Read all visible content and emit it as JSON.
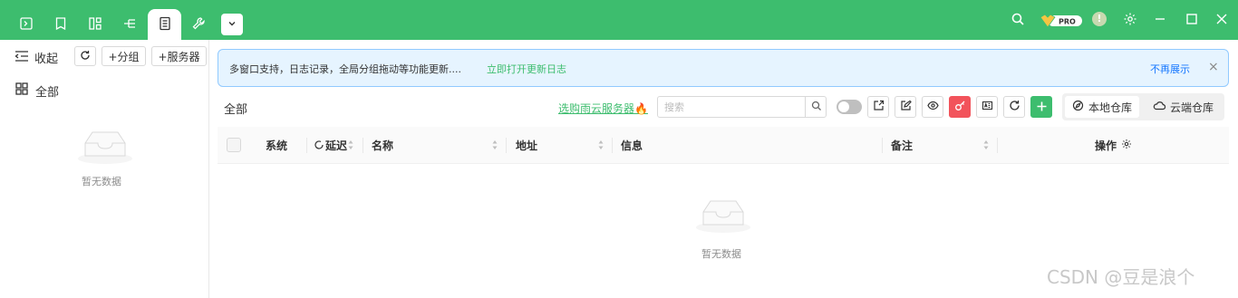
{
  "topbar": {
    "tabs": [
      {
        "icon": "terminal-icon"
      },
      {
        "icon": "bookmark-icon"
      },
      {
        "icon": "grid-tree-icon"
      },
      {
        "icon": "tree-icon"
      },
      {
        "icon": "server-list-icon"
      },
      {
        "icon": "wrench-icon"
      }
    ],
    "active_tab": 4,
    "dropdown_icon": "chevron-down-icon",
    "pro_badge": "PRO",
    "warning_symbol": "!",
    "right_icons": [
      "search-icon",
      "pro-badge",
      "warning-icon",
      "gear-icon",
      "minimize-icon",
      "maximize-icon",
      "close-icon"
    ],
    "accent_color": "#3dbd6e"
  },
  "sidebar": {
    "collapse_label": "收起",
    "add_group_label": "+分组",
    "add_server_label": "+服务器",
    "all_label": "全部",
    "empty_text": "暂无数据"
  },
  "notice": {
    "text": "多窗口支持，日志记录，全局分组拖动等功能更新....",
    "link": "立即打开更新日志",
    "dismiss": "不再展示",
    "close": "×"
  },
  "main": {
    "title": "全部",
    "buy_link": "选购雨云服务器🔥",
    "search_placeholder": "搜索",
    "toggle_on": false,
    "repo_tabs": [
      "本地仓库",
      "云端仓库"
    ],
    "active_repo": 0
  },
  "table": {
    "columns": [
      "系统",
      "延迟",
      "名称",
      "地址",
      "信息",
      "备注",
      "操作"
    ],
    "empty_text": "暂无数据"
  },
  "watermark": "CSDN @豆是浪个"
}
